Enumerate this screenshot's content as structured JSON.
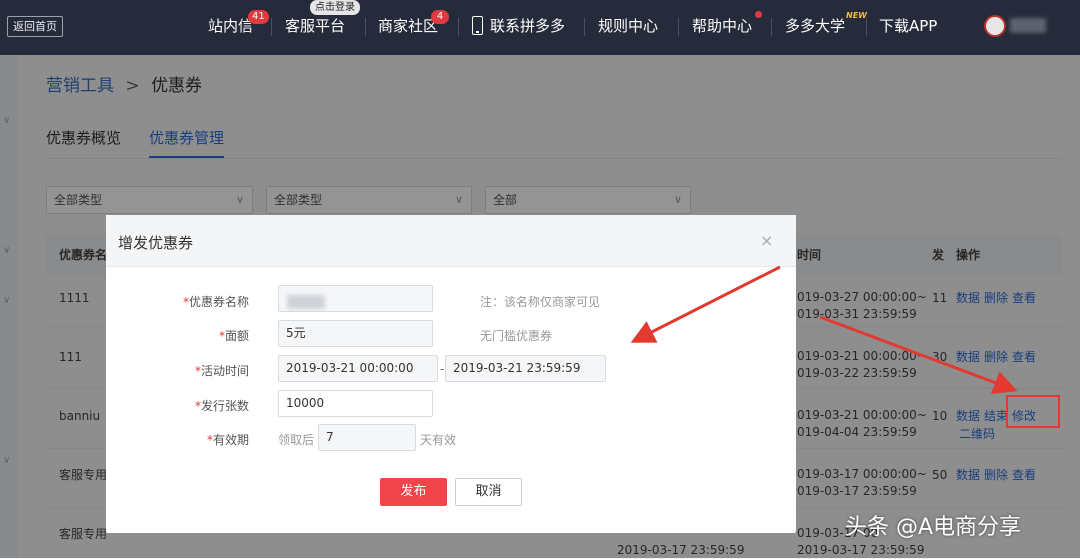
{
  "topnav": {
    "back_home": "返回首页",
    "items": [
      {
        "label": "站内信",
        "badge": "41"
      },
      {
        "label": "客服平台",
        "tip": "点击登录"
      },
      {
        "label": "商家社区",
        "badge": "4"
      },
      {
        "label": "联系拼多多"
      },
      {
        "label": "规则中心"
      },
      {
        "label": "帮助中心"
      },
      {
        "label": "多多大学",
        "tag": "NEW"
      },
      {
        "label": "下载APP"
      }
    ]
  },
  "breadcrumb": {
    "parent": "营销工具",
    "separator": ">",
    "current": "优惠券"
  },
  "tabs": [
    "优惠券概览",
    "优惠券管理"
  ],
  "filters": [
    "全部类型",
    "全部类型",
    "全部"
  ],
  "table": {
    "headers": {
      "name": "优惠券名",
      "time": "时间",
      "issued": "发",
      "ops": "操作"
    },
    "rows": [
      {
        "name": "1111",
        "time1": "019-03-27 00:00:00~",
        "time2": "019-03-31 23:59:59",
        "issued": "11",
        "ops": [
          "数据",
          "删除",
          "查看"
        ]
      },
      {
        "name": "111",
        "time1": "019-03-21 00:00:00~",
        "time2": "019-03-22 23:59:59",
        "issued": "30",
        "ops": [
          "数据",
          "删除",
          "查看"
        ]
      },
      {
        "name": "banniu",
        "time1": "019-03-21 00:00:00~",
        "time2": "019-04-04 23:59:59",
        "issued": "10",
        "ops": [
          "数据",
          "结束",
          "修改"
        ],
        "extra": "二维码"
      },
      {
        "name": "客服专用",
        "time1": "019-03-17 00:00:00~",
        "time2": "019-03-17 23:59:59",
        "issued": "50",
        "ops": [
          "数据",
          "删除",
          "查看"
        ]
      },
      {
        "name": "客服专用",
        "time1": "019-03-17 00",
        "time2": "2019-03-17 23:59:59",
        "extra_time": "2019-03-17 23:59:59"
      }
    ]
  },
  "modal": {
    "title": "增发优惠券",
    "close": "×",
    "fields": {
      "name_label": "优惠券名称",
      "name_hint": "注：该名称仅商家可见",
      "amount_label": "面额",
      "amount_value": "5元",
      "amount_hint": "无门槛优惠券",
      "time_label": "活动时间",
      "time_start": "2019-03-21 00:00:00",
      "time_sep": "-",
      "time_end": "2019-03-21 23:59:59",
      "count_label": "发行张数",
      "count_value": "10000",
      "valid_label": "有效期",
      "valid_prefix": "领取后",
      "valid_days": "7",
      "valid_suffix": "天有效"
    },
    "required_mark": "*",
    "publish_label": "发布",
    "cancel_label": "取消"
  },
  "watermark": "头条 @A电商分享",
  "colors": {
    "accent_red": "#e23a2e",
    "primary_blue": "#2c6cd9",
    "nav_bg": "#262b3b"
  }
}
